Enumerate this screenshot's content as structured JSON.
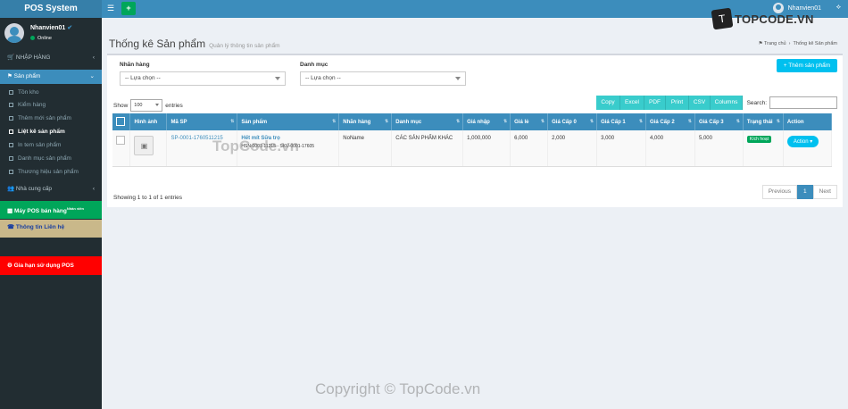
{
  "app": {
    "title": "POS System"
  },
  "topbar": {
    "menu_icon": "bars-icon",
    "plus_label": "+",
    "username": "Nhanvien01"
  },
  "sidebar": {
    "user": {
      "name": "Nhanvien01",
      "status": "Online"
    },
    "items": [
      {
        "label": "NHẬP HÀNG"
      },
      {
        "label": "Sản phẩm"
      },
      {
        "label": "Nhà cung cấp"
      },
      {
        "label": "Máy POS bán hàng",
        "sup": "Nhân viên"
      },
      {
        "label": "Thông tin Liên hệ"
      },
      {
        "label": "Gia hạn sử dụng POS"
      }
    ],
    "subitems": [
      "Tồn kho",
      "Kiểm hàng",
      "Thêm mới sản phẩm",
      "Liệt kê sản phẩm",
      "In tem sản phẩm",
      "Danh mục sản phẩm",
      "Thương hiệu sản phẩm"
    ]
  },
  "page": {
    "title": "Thống kê Sản phẩm",
    "subtitle": "Quản lý thông tin sản phẩm",
    "breadcrumb_home": "Trang chủ",
    "breadcrumb_current": "Thống kê Sản phẩm"
  },
  "filters": {
    "brand_label": "Nhãn hàng",
    "brand_value": "-- Lựa chọn --",
    "category_label": "Danh mục",
    "category_value": "-- Lựa chọn --"
  },
  "add_button": "+ Thêm sản phẩm",
  "table_ctrl": {
    "show": "Show",
    "page_size": "100",
    "entries": "entries",
    "search": "Search:"
  },
  "export_buttons": [
    "Copy",
    "Excel",
    "PDF",
    "Print",
    "CSV",
    "Columns"
  ],
  "table": {
    "headers": [
      "",
      "Hình ảnh",
      "Mã SP",
      "Sản phẩm",
      "Nhãn hàng",
      "Danh mục",
      "Giá nhập",
      "Giá lẻ",
      "Giá Cấp 0",
      "Giá Cấp 1",
      "Giá Cấp 2",
      "Giá Cấp 3",
      "Trạng thái",
      "Action"
    ],
    "row": {
      "code": "SP-0001-1760511215",
      "name": "Hết mít Sữa trọ",
      "sku": "HSN-0001-11215 - SKU-0001-17605",
      "brand": "NoName",
      "category": "CÁC SẢN PHẨM KHÁC",
      "gia_nhap": "1,000,000",
      "gia_le": "6,000",
      "gia_0": "2,000",
      "gia_1": "3,000",
      "gia_2": "4,000",
      "gia_3": "5,000",
      "status": "Kích hoạt",
      "action": "Action"
    }
  },
  "info": "Showing 1 to 1 of 1 entries",
  "pager": {
    "prev": "Previous",
    "page": "1",
    "next": "Next"
  },
  "watermark": {
    "logo_text": "TOPCODE.VN",
    "mid": "TopCode.vn",
    "bottom": "Copyright © TopCode.vn"
  }
}
